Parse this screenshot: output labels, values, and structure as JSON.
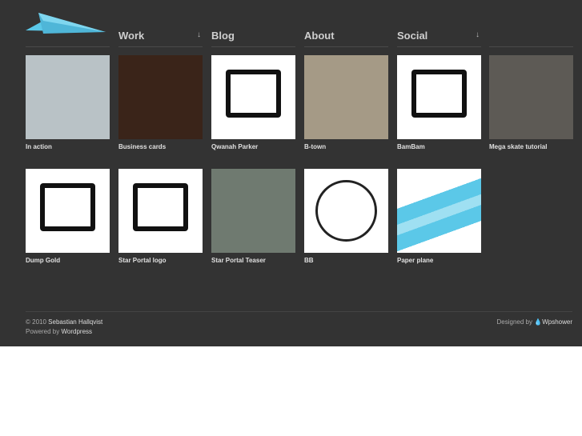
{
  "nav": [
    {
      "label": "Work",
      "arrow": "↓"
    },
    {
      "label": "Blog"
    },
    {
      "label": "About"
    },
    {
      "label": "Social",
      "arrow": "↓"
    }
  ],
  "items": [
    {
      "label": "In action",
      "bg": "#b9c2c6"
    },
    {
      "label": "Business cards",
      "bg": "#3a2419"
    },
    {
      "label": "Qwanah Parker",
      "bg": "#ffffff"
    },
    {
      "label": "B-town",
      "bg": "#a59a86"
    },
    {
      "label": "BamBam",
      "bg": "#ffffff"
    },
    {
      "label": "Mega skate tutorial",
      "bg": "#5d5a55"
    },
    {
      "label": "Dump Gold",
      "bg": "#ffffff"
    },
    {
      "label": "Star Portal logo",
      "bg": "#ffffff"
    },
    {
      "label": "Star Portal Teaser",
      "bg": "#6f7a70"
    },
    {
      "label": "BB",
      "bg": "#ffffff"
    },
    {
      "label": "Paper plane",
      "bg": "#ffffff"
    }
  ],
  "footer": {
    "copyright": "© 2010",
    "author": "Sebastian Hallqvist",
    "powered_prefix": "Powered by",
    "powered": "Wordpress",
    "designed_prefix": "Designed by",
    "designer": "Wpshower"
  },
  "colors": {
    "background": "#333333",
    "accent": "#5bc8e8"
  }
}
